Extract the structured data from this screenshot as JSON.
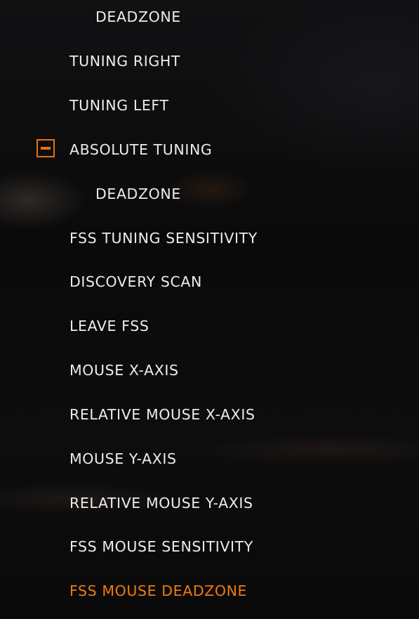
{
  "menu": {
    "items": [
      {
        "label": "DEADZONE",
        "level": 2
      },
      {
        "label": "TUNING RIGHT",
        "level": 1
      },
      {
        "label": "TUNING LEFT",
        "level": 1
      },
      {
        "label": "ABSOLUTE TUNING",
        "level": 1,
        "icon": "minus-square-icon"
      },
      {
        "label": "DEADZONE",
        "level": 2
      },
      {
        "label": "FSS TUNING SENSITIVITY",
        "level": 1
      },
      {
        "label": "DISCOVERY SCAN",
        "level": 1
      },
      {
        "label": "LEAVE FSS",
        "level": 1
      },
      {
        "label": "MOUSE X-AXIS",
        "level": 1
      },
      {
        "label": "RELATIVE MOUSE X-AXIS",
        "level": 1
      },
      {
        "label": "MOUSE Y-AXIS",
        "level": 1
      },
      {
        "label": "RELATIVE MOUSE Y-AXIS",
        "level": 1
      },
      {
        "label": "FSS MOUSE SENSITIVITY",
        "level": 1
      },
      {
        "label": "FSS MOUSE DEADZONE",
        "level": 1,
        "selected": true
      }
    ]
  },
  "colors": {
    "text": "#ececec",
    "accent": "#f07a10",
    "background": "#0b0b0c"
  }
}
